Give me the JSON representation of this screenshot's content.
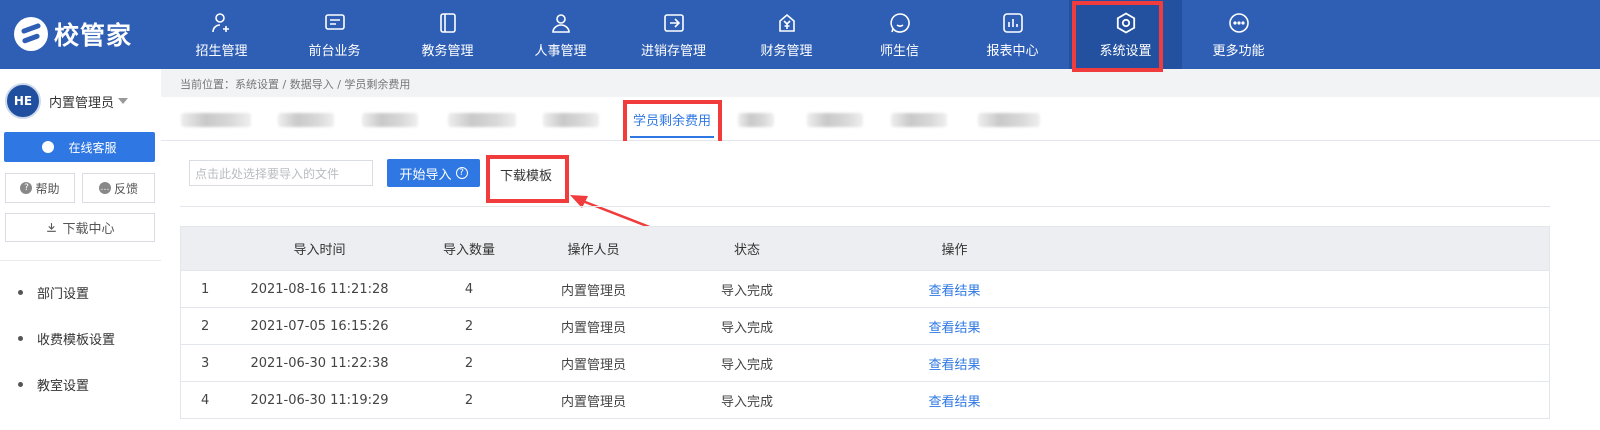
{
  "app": {
    "logo_text": "校管家"
  },
  "nav": [
    {
      "label": "招生管理",
      "icon": "user-add-icon"
    },
    {
      "label": "前台业务",
      "icon": "monitor-icon"
    },
    {
      "label": "教务管理",
      "icon": "book-icon"
    },
    {
      "label": "人事管理",
      "icon": "person-icon"
    },
    {
      "label": "进销存管理",
      "icon": "inventory-icon"
    },
    {
      "label": "财务管理",
      "icon": "yuan-icon"
    },
    {
      "label": "师生信",
      "icon": "chat-icon"
    },
    {
      "label": "报表中心",
      "icon": "bar-chart-icon"
    },
    {
      "label": "系统设置",
      "icon": "settings-icon",
      "active": true
    },
    {
      "label": "更多功能",
      "icon": "more-icon"
    }
  ],
  "sidebar": {
    "avatar_text": "HE",
    "user_name": "内置管理员",
    "online_service": "在线客服",
    "help": "帮助",
    "feedback": "反馈",
    "download_center": "下载中心",
    "menu": [
      {
        "label": "部门设置"
      },
      {
        "label": "收费模板设置"
      },
      {
        "label": "教室设置"
      }
    ]
  },
  "breadcrumb": "当前位置：系统设置 / 数据导入 / 学员剩余费用",
  "tabs": {
    "active_label": "学员剩余费用"
  },
  "import": {
    "file_placeholder": "点击此处选择要导入的文件",
    "start_import": "开始导入",
    "download_template": "下载模板"
  },
  "table": {
    "headers": [
      "",
      "导入时间",
      "导入数量",
      "操作人员",
      "状态",
      "操作"
    ],
    "rows": [
      {
        "index": "1",
        "time": "2021-08-16 11:21:28",
        "count": "4",
        "operator": "内置管理员",
        "status": "导入完成",
        "action": "查看结果"
      },
      {
        "index": "2",
        "time": "2021-07-05 16:15:26",
        "count": "2",
        "operator": "内置管理员",
        "status": "导入完成",
        "action": "查看结果"
      },
      {
        "index": "3",
        "time": "2021-06-30 11:22:38",
        "count": "2",
        "operator": "内置管理员",
        "status": "导入完成",
        "action": "查看结果"
      },
      {
        "index": "4",
        "time": "2021-06-30 11:19:29",
        "count": "2",
        "operator": "内置管理员",
        "status": "导入完成",
        "action": "查看结果"
      }
    ]
  },
  "colors": {
    "topbar": "#2f5fb4",
    "accent": "#2f78e4",
    "highlight": "#f03c3c"
  }
}
